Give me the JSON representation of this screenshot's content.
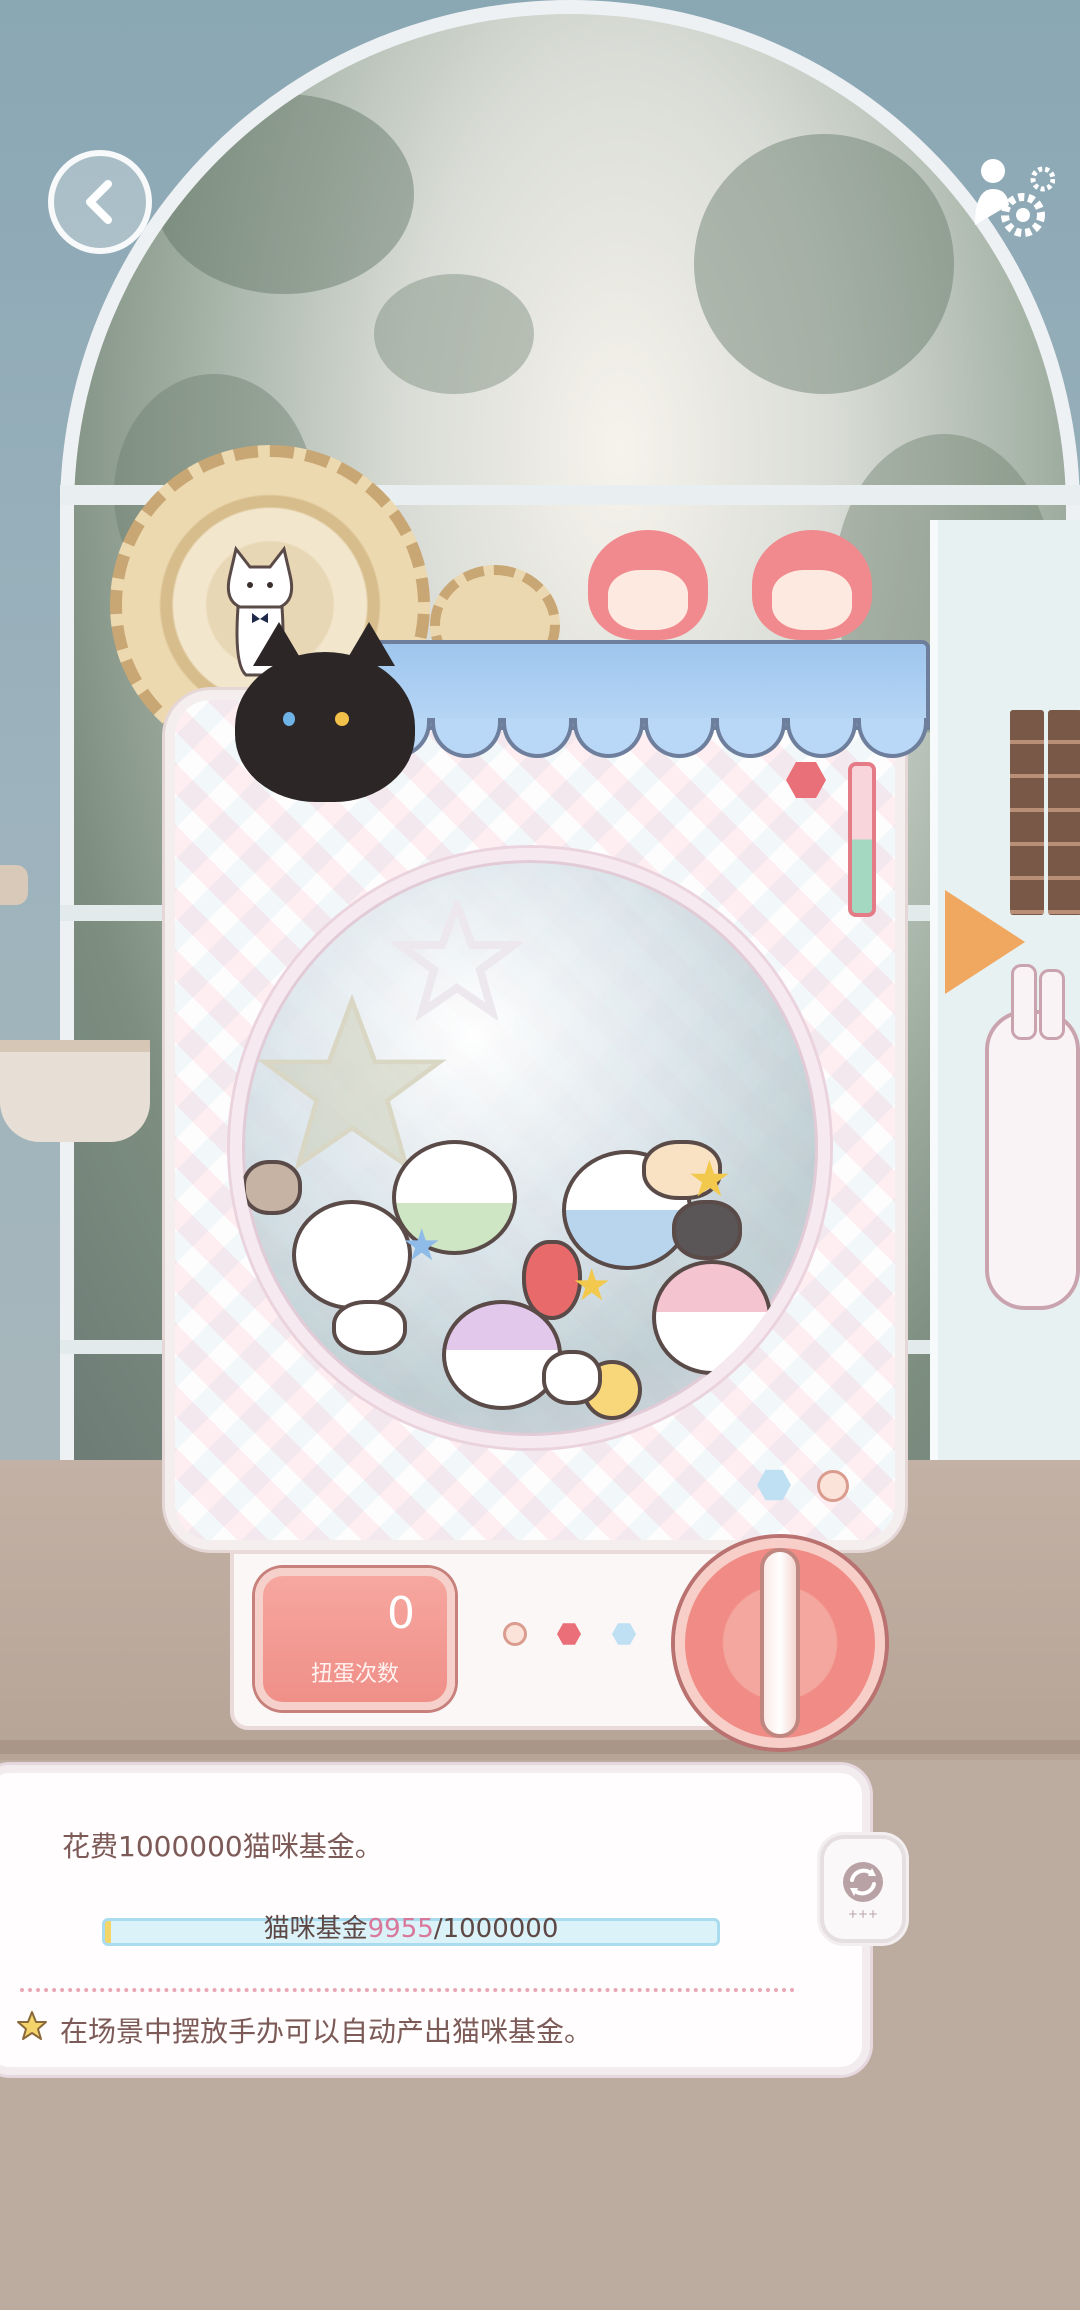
{
  "top_bar": {
    "back_icon": "chevron-left-icon",
    "settings_icon": "gear-icon"
  },
  "machine": {
    "counter": {
      "value": "0",
      "label": "扭蛋次数"
    }
  },
  "info_panel": {
    "cost_text": "花费1000000猫咪基金。",
    "fund": {
      "label": "猫咪基金",
      "current": "9955",
      "separator": "/",
      "target": "1000000",
      "progress_fraction": 0.009955
    },
    "tip_text": "在场景中摆放手办可以自动产出猫咪基金。",
    "refresh_icon": "refresh-icon"
  },
  "colors": {
    "accent_pink": "#ef8f88",
    "fund_highlight": "#d9779b",
    "text_brown": "#7c5a57"
  }
}
